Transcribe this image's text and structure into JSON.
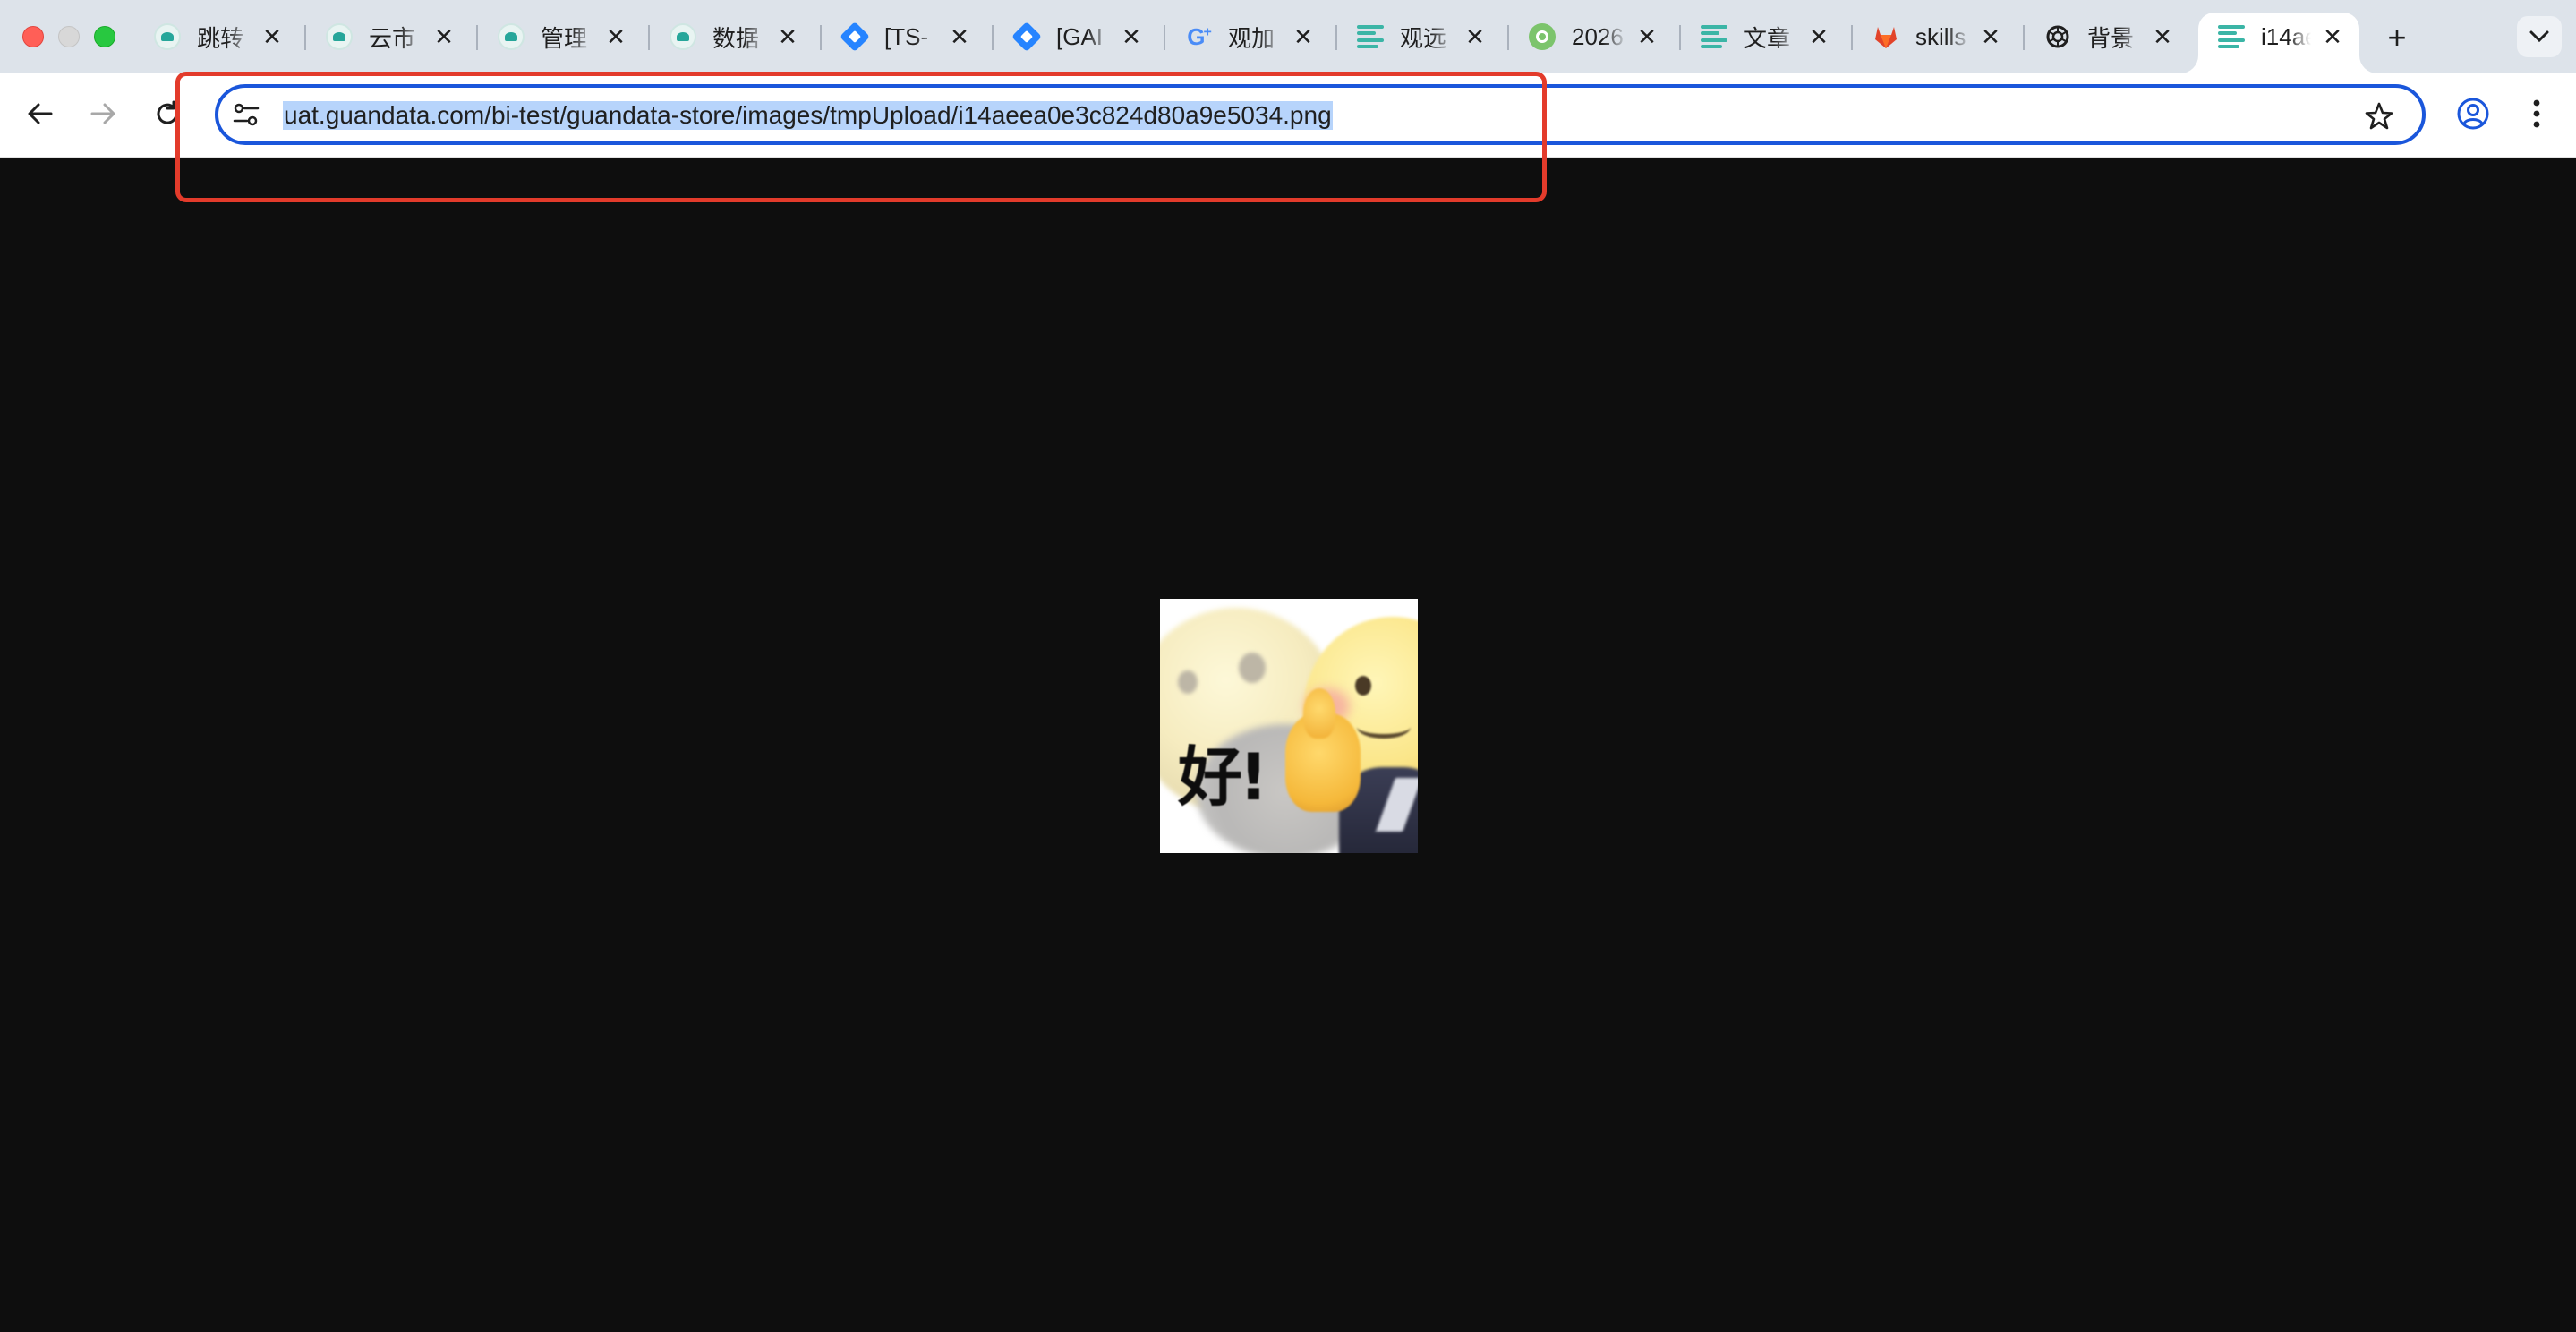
{
  "browser": {
    "tabs": [
      {
        "title": "跳转",
        "favicon": "guandata-icon",
        "active": false
      },
      {
        "title": "云市",
        "favicon": "guandata-icon",
        "active": false
      },
      {
        "title": "管理",
        "favicon": "guandata-icon",
        "active": false
      },
      {
        "title": "数据",
        "favicon": "guandata-icon",
        "active": false
      },
      {
        "title": "[TS-",
        "favicon": "jira-icon",
        "active": false
      },
      {
        "title": "[GAI",
        "favicon": "jira-icon",
        "active": false
      },
      {
        "title": "观加",
        "favicon": "google-plus-icon",
        "active": false
      },
      {
        "title": "观远",
        "favicon": "doc-lines-icon",
        "active": false
      },
      {
        "title": "2026",
        "favicon": "green-circle-icon",
        "active": false
      },
      {
        "title": "文章",
        "favicon": "doc-lines-icon",
        "active": false
      },
      {
        "title": "skills",
        "favicon": "gitlab-icon",
        "active": false
      },
      {
        "title": "背景",
        "favicon": "openai-icon",
        "active": false
      },
      {
        "title": "i14ae",
        "favicon": "doc-lines-icon",
        "active": true
      }
    ],
    "close_glyph": "✕",
    "new_tab_glyph": "+",
    "address_bar": {
      "url": "uat.guandata.com/bi-test/guandata-store/images/tmpUpload/i14aeea0e3c824d80a9e5034.png",
      "selected": true
    }
  },
  "viewer": {
    "image_caption_text": "好!",
    "background_color": "#0e0e0e"
  },
  "annotation": {
    "color": "#e33b2b"
  }
}
